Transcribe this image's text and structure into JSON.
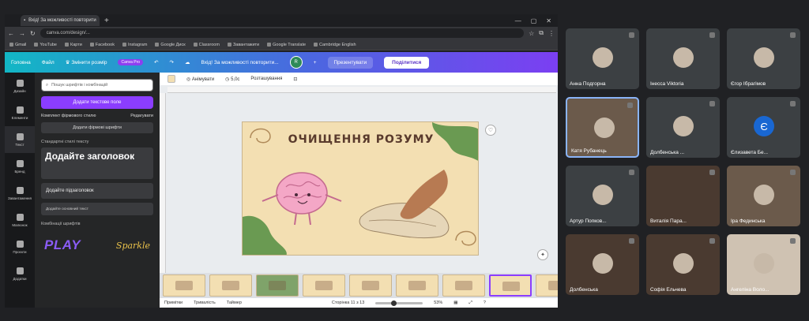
{
  "browser": {
    "tab_title": "Вхід! За можливості повторити",
    "address": "canva.com/design/...",
    "bookmarks": [
      "Gmail",
      "YouTube",
      "Карти",
      "Facebook",
      "Instagram",
      "Google Диск",
      "Classroom",
      "Завантажити",
      "Google Translate",
      "Cambridge English"
    ]
  },
  "canva": {
    "menu_home": "Головна",
    "menu_file": "Файл",
    "menu_resize": "Змінити розмір",
    "badge_pro": "Canva Pro",
    "doc_title": "Вхід! За можливості повторити...",
    "present_label": "Презентувати",
    "share_label": "Поділитися",
    "user_initial": "R"
  },
  "rail": [
    "Дизайн",
    "Елементи",
    "Текст",
    "Бренд",
    "Завантаження",
    "Малюнок",
    "Проєкти",
    "Додатки"
  ],
  "panel": {
    "search_placeholder": "Пошук шрифтів і комбінацій",
    "add_textbox": "Додати текстове поле",
    "brand_kit": "Комплект фірмового стилю",
    "brand_edit": "Редагувати",
    "brand_btn": "Додати фірмові шрифти",
    "defaults_section": "Стандартні стилі тексту",
    "heading": "Додайте заголовок",
    "subheading": "Додайте підзаголовок",
    "body": "Додайте основний текст",
    "combos_section": "Комбінації шрифтів",
    "font_combo_1": "PLAY",
    "font_combo_2": "Sparkle"
  },
  "workspace": {
    "ctx_animate": "Анімувати",
    "ctx_duration": "5,0с",
    "ctx_position": "Розташування",
    "slide_title": "ОЧИЩЕННЯ РОЗУМУ",
    "notes": "Примітки",
    "duration": "Тривалість",
    "timer": "Таймер",
    "page_indicator": "Сторінка 11 з 13",
    "zoom": "53%"
  },
  "colors": {
    "slide_bg": "#f3dfb2",
    "brain_pink": "#f4a7c6",
    "blob_green": "#6a9a52",
    "canva_purple": "#8b3dff"
  },
  "participants": [
    {
      "name": "Анна Подгорна"
    },
    {
      "name": "Iнeсса Viktoria"
    },
    {
      "name": "Єгор Ібрагімов"
    },
    {
      "name": "Катя Рубанець"
    },
    {
      "name": "Долбенська ..."
    },
    {
      "name": "Єлизавета Бе..."
    },
    {
      "name": "Артур Попков..."
    },
    {
      "name": "Виталія Пара..."
    },
    {
      "name": "Ірa Фединська"
    },
    {
      "name": "Долбенська"
    },
    {
      "name": "Софія Ельчева"
    },
    {
      "name": "Ангеліна Воло..."
    }
  ],
  "participant_initial": "Є"
}
